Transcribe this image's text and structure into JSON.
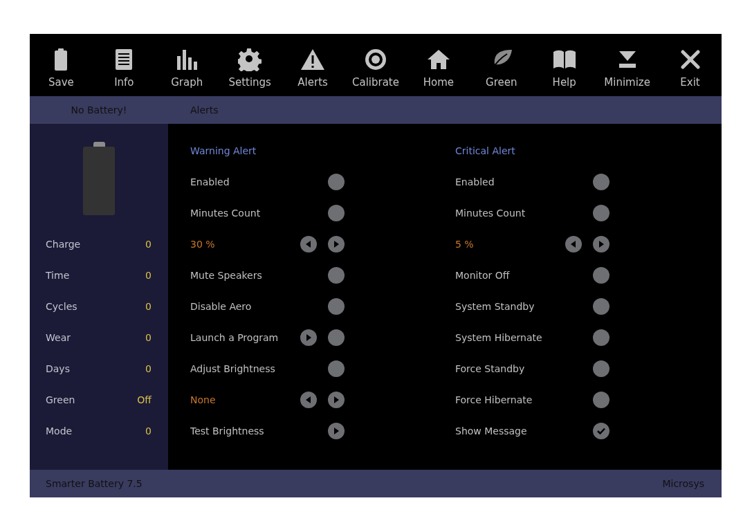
{
  "toolbar": [
    {
      "label": "Save"
    },
    {
      "label": "Info"
    },
    {
      "label": "Graph"
    },
    {
      "label": "Settings"
    },
    {
      "label": "Alerts"
    },
    {
      "label": "Calibrate"
    },
    {
      "label": "Home"
    },
    {
      "label": "Green"
    },
    {
      "label": "Help"
    },
    {
      "label": "Minimize"
    },
    {
      "label": "Exit"
    }
  ],
  "header": {
    "status": "No Battery!",
    "section": "Alerts"
  },
  "sidebar": {
    "stats": [
      {
        "label": "Charge",
        "value": "0"
      },
      {
        "label": "Time",
        "value": "0"
      },
      {
        "label": "Cycles",
        "value": "0"
      },
      {
        "label": "Wear",
        "value": "0"
      },
      {
        "label": "Days",
        "value": "0"
      },
      {
        "label": "Green",
        "value": "Off"
      },
      {
        "label": "Mode",
        "value": "0"
      }
    ]
  },
  "columns": [
    {
      "title": "Warning Alert",
      "rows": [
        {
          "kind": "toggle",
          "label": "Enabled",
          "checked": false
        },
        {
          "kind": "toggle",
          "label": "Minutes Count",
          "checked": false
        },
        {
          "kind": "stepper",
          "value": "30 %"
        },
        {
          "kind": "toggle",
          "label": "Mute Speakers",
          "checked": false
        },
        {
          "kind": "toggle",
          "label": "Disable Aero",
          "checked": false
        },
        {
          "kind": "launch",
          "label": "Launch a Program",
          "checked": false
        },
        {
          "kind": "toggle",
          "label": "Adjust Brightness",
          "checked": false
        },
        {
          "kind": "stepper",
          "value": "None"
        },
        {
          "kind": "action",
          "label": "Test Brightness"
        }
      ]
    },
    {
      "title": "Critical Alert",
      "rows": [
        {
          "kind": "toggle",
          "label": "Enabled",
          "checked": false
        },
        {
          "kind": "toggle",
          "label": "Minutes Count",
          "checked": false
        },
        {
          "kind": "stepper",
          "value": "5 %"
        },
        {
          "kind": "toggle",
          "label": "Monitor Off",
          "checked": false
        },
        {
          "kind": "toggle",
          "label": "System Standby",
          "checked": false
        },
        {
          "kind": "toggle",
          "label": "System Hibernate",
          "checked": false
        },
        {
          "kind": "toggle",
          "label": "Force Standby",
          "checked": false
        },
        {
          "kind": "toggle",
          "label": "Force Hibernate",
          "checked": false
        },
        {
          "kind": "toggle",
          "label": "Show Message",
          "checked": true
        }
      ]
    }
  ],
  "footer": {
    "app": "Smarter Battery 7.5",
    "vendor": "Microsys"
  }
}
